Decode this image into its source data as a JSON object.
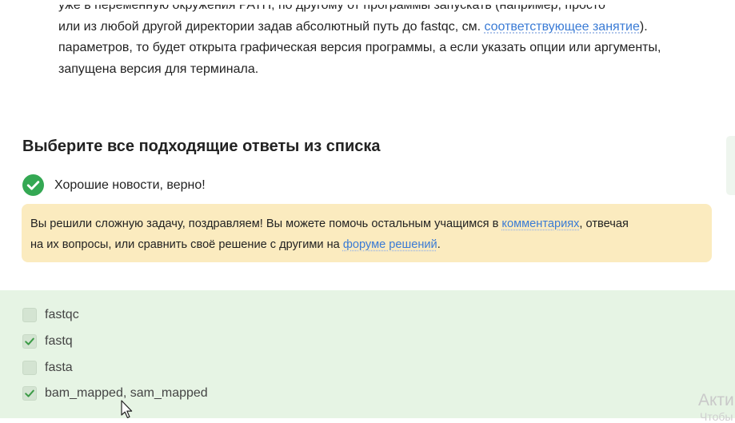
{
  "lesson_text": {
    "line1": "уже в переменную окружения PATH, по другому от программы запускать (например, просто",
    "line2_before_link": "или из любой другой директории задав абсолютный путь до fastqc, см. ",
    "line2_link": "соответствующее занятие",
    "line2_after_link": ").",
    "line3": "параметров, то будет открыта графическая версия программы, а если указать опции или аргументы,",
    "line4": "запущена версия для терминала."
  },
  "question": {
    "title": "Выберите все подходящие ответы из списка"
  },
  "feedback": {
    "status_icon": "check-circle-icon",
    "status_color": "#34a853",
    "status_text": "Хорошие новости, верно!",
    "hint_line1_before": "Вы решили сложную задачу, поздравляем! Вы можете помочь остальным учащимся в ",
    "hint_line1_link": "комментариях",
    "hint_line1_after": ", отвечая",
    "hint_line2_before": "на их вопросы, или сравнить своё решение с другими на ",
    "hint_line2_link": "форуме решений",
    "hint_line2_after": ".",
    "hint_bg": "#fbebbf"
  },
  "options": [
    {
      "label": "fastqc",
      "checked": false
    },
    {
      "label": "fastq",
      "checked": true
    },
    {
      "label": "fasta",
      "checked": false
    },
    {
      "label": "bam_mapped, sam_mapped",
      "checked": true
    }
  ],
  "colors": {
    "link": "#3a7bd5",
    "options_bg": "#e6f4e4",
    "check": "#3c9b46"
  },
  "watermark": {
    "line1": "Акти",
    "line2": "Чтобы"
  }
}
